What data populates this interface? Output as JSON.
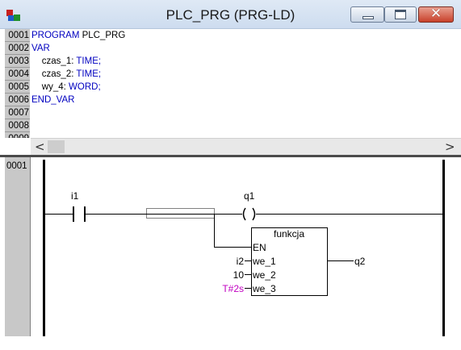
{
  "window": {
    "title": "PLC_PRG (PRG-LD)",
    "controls": [
      "minimize",
      "maximize",
      "close"
    ],
    "close_glyph": "✕"
  },
  "declaration": {
    "line_numbers": [
      "0001",
      "0002",
      "0003",
      "0004",
      "0005",
      "0006",
      "0007",
      "0008",
      "0009"
    ],
    "lines": [
      [
        {
          "t": "PROGRAM",
          "k": true
        },
        {
          "t": " PLC_PRG",
          "k": false
        }
      ],
      [
        {
          "t": "VAR",
          "k": true
        }
      ],
      [
        {
          "t": "    czas_1: ",
          "k": false
        },
        {
          "t": "TIME",
          "k": true
        },
        {
          "t": ";",
          "k": true
        }
      ],
      [
        {
          "t": "    czas_2: ",
          "k": false
        },
        {
          "t": "TIME",
          "k": true
        },
        {
          "t": ";",
          "k": true
        }
      ],
      [
        {
          "t": "    wy_4: ",
          "k": false
        },
        {
          "t": "WORD",
          "k": true
        },
        {
          "t": ";",
          "k": true
        }
      ],
      [
        {
          "t": "END_VAR",
          "k": true
        }
      ]
    ]
  },
  "scrollbar": {
    "left_arrow": "<",
    "right_arrow": ">"
  },
  "network": {
    "number": "0001",
    "contact_label": "i1",
    "coil_label": "q1",
    "block": {
      "name": "funkcja",
      "inputs": [
        {
          "pin": "EN",
          "arg": ""
        },
        {
          "pin": "we_1",
          "arg": "i2"
        },
        {
          "pin": "we_2",
          "arg": "10"
        },
        {
          "pin": "we_3",
          "arg": "T#2s"
        }
      ],
      "output_arg": "q2"
    }
  },
  "colors": {
    "keyword": "#0000c0",
    "time_literal": "#c000c0",
    "gutter": "#c8c8c8"
  }
}
